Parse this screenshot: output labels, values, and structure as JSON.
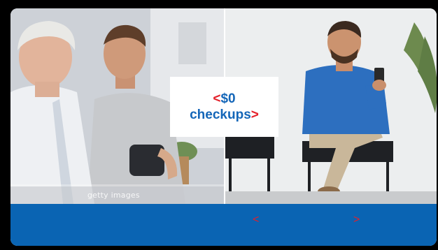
{
  "hero": {
    "headline_line1": "$0",
    "headline_line2": "checkups",
    "open_bracket": "<",
    "close_bracket": ">",
    "watermark": "getty images"
  },
  "carousel": {
    "prev_label": "<",
    "next_label": ">"
  },
  "colors": {
    "brand_blue": "#0a64b3",
    "text_blue": "#1466b8",
    "accent_red": "#e4202a"
  }
}
